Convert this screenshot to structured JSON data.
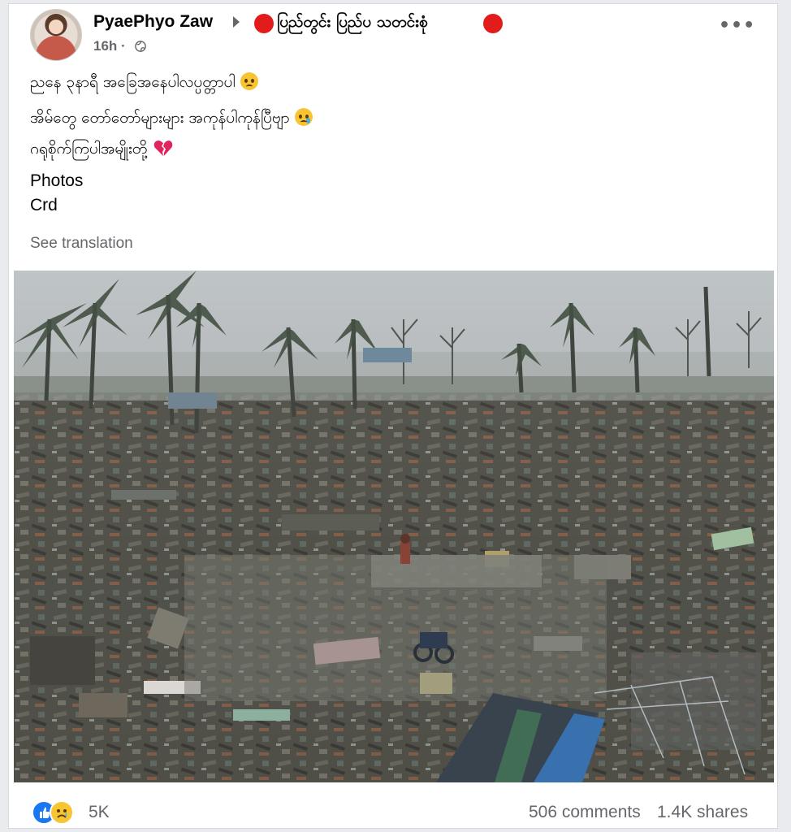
{
  "post": {
    "author": "PyaePhyo Zaw",
    "group": "ပြည်တွင်း ပြည်ပ သတင်းစုံ",
    "time": "16h",
    "time_separator": "·",
    "more_label": "•••",
    "lines": [
      "ညနေ ၃နာရီ အခြေအနေပါလပ္ပတ္တာပါ",
      "အိမ်တွေ တော်တော်များများ အကုန်ပါကုန်ပြီဗျာ",
      "ဂရုစိုက်ကြပါအမျိုးတို့"
    ],
    "photos_label": "Photos",
    "credit_label": "Crd",
    "see_translation": "See translation"
  },
  "footer": {
    "reactions_count": "5K",
    "comments": "506 comments",
    "shares": "1.4K shares"
  },
  "icons": {
    "privacy": "globe-icon",
    "reaction_1": "like-icon",
    "reaction_2": "sad-icon",
    "line_1_emoji": "sad-face-icon",
    "line_2_emoji": "crying-face-icon",
    "line_3_emoji": "broken-heart-icon"
  },
  "colors": {
    "accent_blue": "#1877f2",
    "status_red": "#e21b1b",
    "secondary_text": "#65676b"
  }
}
